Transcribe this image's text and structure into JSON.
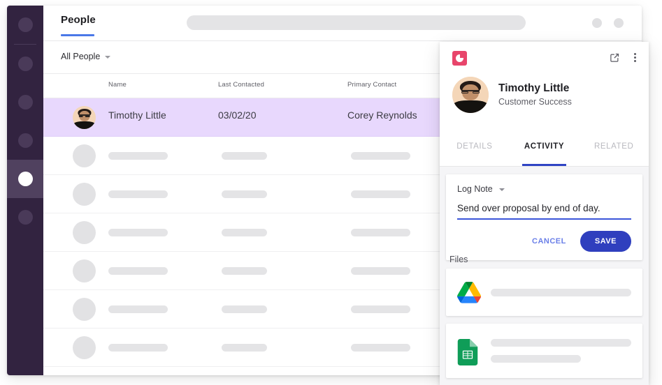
{
  "app": {
    "tab_label": "People",
    "search_placeholder": "",
    "filter_label": "All People"
  },
  "table": {
    "columns": [
      "Name",
      "Last Contacted",
      "Primary Contact"
    ],
    "selected_row": {
      "name": "Timothy Little",
      "last_contacted": "03/02/20",
      "primary_contact": "Corey Reynolds"
    },
    "placeholder_row_count": 6
  },
  "sidebar": {
    "items": [
      {
        "name": "sidebar-item-1",
        "active": false
      },
      {
        "name": "sidebar-item-2",
        "active": false
      },
      {
        "name": "sidebar-item-3",
        "active": false
      },
      {
        "name": "sidebar-item-4",
        "active": false
      },
      {
        "name": "sidebar-item-5",
        "active": true
      },
      {
        "name": "sidebar-item-6",
        "active": false
      }
    ]
  },
  "panel": {
    "logo_icon": "copper-crm-logo-icon",
    "open_in_new_icon": "open-in-new-icon",
    "more_icon": "kebab-menu-icon",
    "person": {
      "name": "Timothy Little",
      "role": "Customer Success",
      "avatar": "person-photo-avatar"
    },
    "tabs": [
      {
        "label": "DETAILS",
        "active": false
      },
      {
        "label": "ACTIVITY",
        "active": true
      },
      {
        "label": "RELATED",
        "active": false
      }
    ],
    "note": {
      "type_label": "Log Note",
      "text": "Send over proposal by end of day.",
      "cancel_label": "CANCEL",
      "save_label": "SAVE"
    },
    "files": {
      "heading": "Files",
      "items": [
        {
          "icon": "google-drive-icon",
          "lines": 1
        },
        {
          "icon": "google-sheets-icon",
          "lines": 2
        }
      ]
    }
  },
  "colors": {
    "sidebar_bg": "#322340",
    "row_selected": "#e8d8fd",
    "tab_underline": "#4a78e8",
    "panel_tab_underline": "#2f44c4",
    "save_button": "#2f3fbe",
    "cancel_text": "#6a7fe8",
    "logo_red": "#e8456b",
    "note_input_underline": "#3b55d9",
    "placeholder_gray": "#e4e4e6"
  }
}
